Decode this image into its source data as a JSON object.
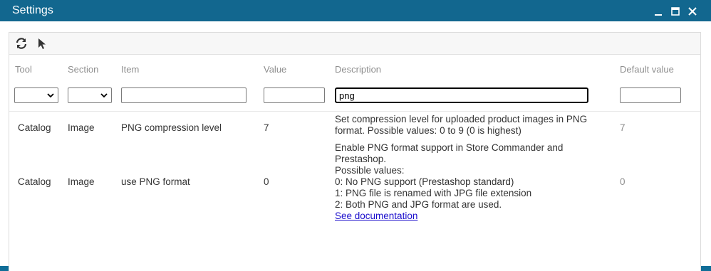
{
  "window": {
    "title": "Settings"
  },
  "columns": {
    "tool": "Tool",
    "section": "Section",
    "item": "Item",
    "value": "Value",
    "description": "Description",
    "default_value": "Default value"
  },
  "filters": {
    "item": "",
    "value": "",
    "description": "png",
    "default_value": ""
  },
  "rows": [
    {
      "tool": "Catalog",
      "section": "Image",
      "item": "PNG compression level",
      "value": "7",
      "description_lines": [
        "Set compression level for uploaded product images in PNG",
        "format. Possible values: 0 to 9 (0 is highest)"
      ],
      "default_value": "7"
    },
    {
      "tool": "Catalog",
      "section": "Image",
      "item": "use PNG format",
      "value": "0",
      "description_lines": [
        "Enable PNG format support in Store Commander and",
        "Prestashop.",
        "Possible values:",
        "0: No PNG support (Prestashop standard)",
        "1: PNG file is renamed with JPG file extension",
        "2: Both PNG and JPG format are used."
      ],
      "link": "See documentation",
      "default_value": "0"
    }
  ],
  "icons": {
    "refresh": "refresh-icon",
    "cursor": "cursor-icon",
    "minimize": "minimize-icon",
    "maximize": "maximize-icon",
    "close": "close-icon"
  }
}
